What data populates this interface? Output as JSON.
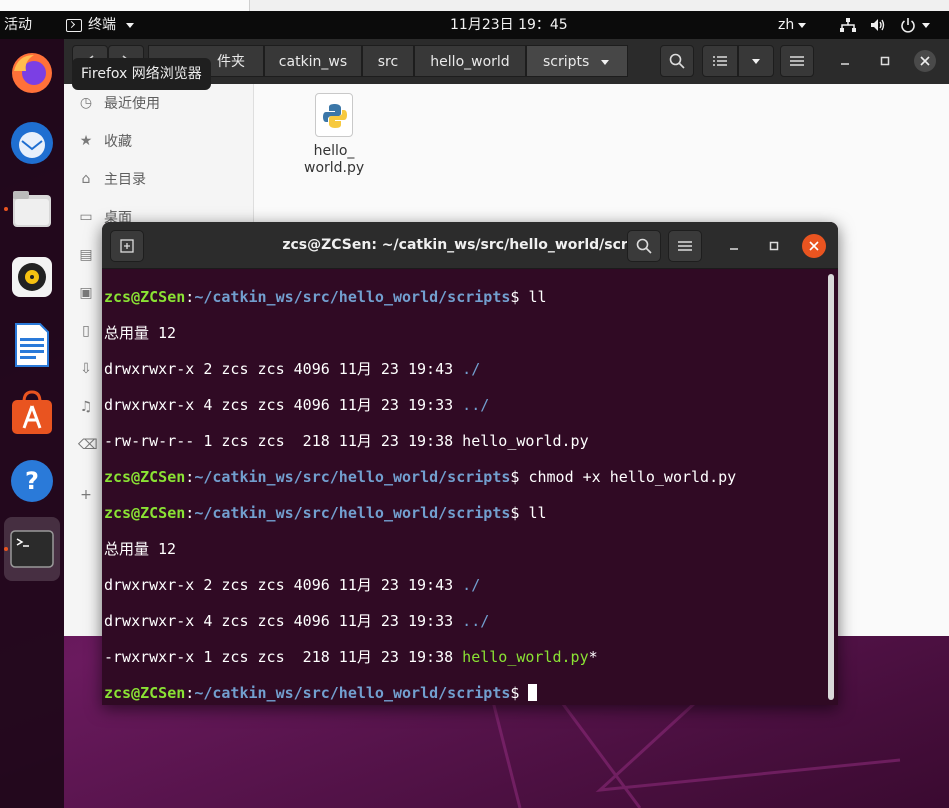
{
  "topbar": {
    "activities": "活动",
    "app_name": "终端",
    "clock": "11月23日 19：45",
    "lang": "zh"
  },
  "dock": {
    "items": [
      {
        "name": "firefox-icon",
        "active": false
      },
      {
        "name": "thunderbird-icon",
        "active": false
      },
      {
        "name": "files-icon",
        "active": false
      },
      {
        "name": "rhythmbox-icon",
        "active": false
      },
      {
        "name": "writer-icon",
        "active": false
      },
      {
        "name": "software-icon",
        "active": false
      },
      {
        "name": "help-icon",
        "active": false
      },
      {
        "name": "terminal-icon",
        "active": true
      }
    ]
  },
  "tooltip": "Firefox 网络浏览器",
  "files": {
    "breadcrumbs": [
      "件夹",
      "catkin_ws",
      "src",
      "hello_world",
      "scripts"
    ],
    "sidebar": [
      {
        "icon": "clock-icon",
        "label": "最近使用"
      },
      {
        "icon": "star-icon",
        "label": "收藏"
      },
      {
        "icon": "home-icon",
        "label": "主目录"
      },
      {
        "icon": "desktop-icon",
        "label": "桌面"
      },
      {
        "icon": "video-icon",
        "label": ""
      },
      {
        "icon": "picture-icon",
        "label": ""
      },
      {
        "icon": "document-icon",
        "label": ""
      },
      {
        "icon": "download-icon",
        "label": ""
      },
      {
        "icon": "music-icon",
        "label": ""
      },
      {
        "icon": "trash-icon",
        "label": ""
      },
      {
        "icon": "plus-icon",
        "label": ""
      }
    ],
    "file": {
      "name_line1": "hello_",
      "name_line2": "world.py"
    }
  },
  "terminal": {
    "title": "zcs@ZCSen: ~/catkin_ws/src/hello_world/scripts",
    "user": "zcs@ZCSen",
    "colon": ":",
    "path": "~/catkin_ws/src/hello_world/scripts",
    "dollar": "$ ",
    "cmd1": "ll",
    "cmd2": "chmod +x hello_world.py",
    "cmd3": "ll",
    "total": "总用量 12",
    "ls1": {
      "row1": "drwxrwxr-x 2 zcs zcs 4096 11月 23 19:43 ",
      "row1_name": "./",
      "row2": "drwxrwxr-x 4 zcs zcs 4096 11月 23 19:33 ",
      "row2_name": "../",
      "row3": "-rw-rw-r-- 1 zcs zcs  218 11月 23 19:38 hello_world.py"
    },
    "ls2": {
      "row1": "drwxrwxr-x 2 zcs zcs 4096 11月 23 19:43 ",
      "row1_name": "./",
      "row2": "drwxrwxr-x 4 zcs zcs 4096 11月 23 19:33 ",
      "row2_name": "../",
      "row3": "-rwxrwxr-x 1 zcs zcs  218 11月 23 19:38 ",
      "row3_name": "hello_world.py",
      "row3_suffix": "*"
    }
  },
  "colors": {
    "terminal_bg": "#300a24",
    "prompt_user": "#8ae234",
    "prompt_path": "#729fcf",
    "accent": "#e95420"
  }
}
